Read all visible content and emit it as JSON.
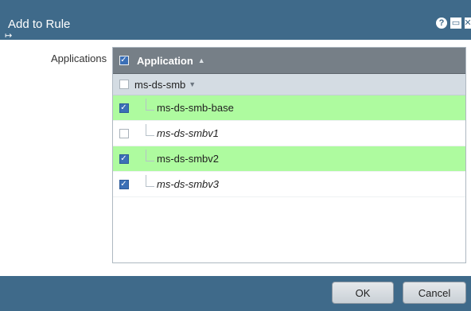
{
  "dialog": {
    "title": "Add to Rule",
    "title_icons": [
      {
        "name": "help-icon",
        "glyph": "?"
      },
      {
        "name": "maximize-icon",
        "glyph": "▭"
      },
      {
        "name": "close-icon",
        "glyph": "✕"
      }
    ]
  },
  "form": {
    "applications_label": "Applications"
  },
  "grid": {
    "header": {
      "column_label": "Application",
      "sort_icon": "sort-ascending-icon",
      "select_all_checked": true
    },
    "rows": [
      {
        "label": "ms-ds-smb",
        "type": "group",
        "checked": false,
        "selected": false,
        "italic": false
      },
      {
        "label": "ms-ds-smb-base",
        "type": "child",
        "checked": true,
        "selected": true,
        "italic": false
      },
      {
        "label": "ms-ds-smbv1",
        "type": "child",
        "checked": false,
        "selected": false,
        "italic": true
      },
      {
        "label": "ms-ds-smbv2",
        "type": "child",
        "checked": true,
        "selected": true,
        "italic": false
      },
      {
        "label": "ms-ds-smbv3",
        "type": "child",
        "checked": true,
        "selected": false,
        "italic": true
      }
    ]
  },
  "footer": {
    "ok_label": "OK",
    "cancel_label": "Cancel"
  },
  "colors": {
    "titlebar": "#3f6a8a",
    "header": "#767f87",
    "group_row": "#d4dce3",
    "selected_row": "#aefb9f",
    "checkbox_checked": "#3b6fb6"
  }
}
